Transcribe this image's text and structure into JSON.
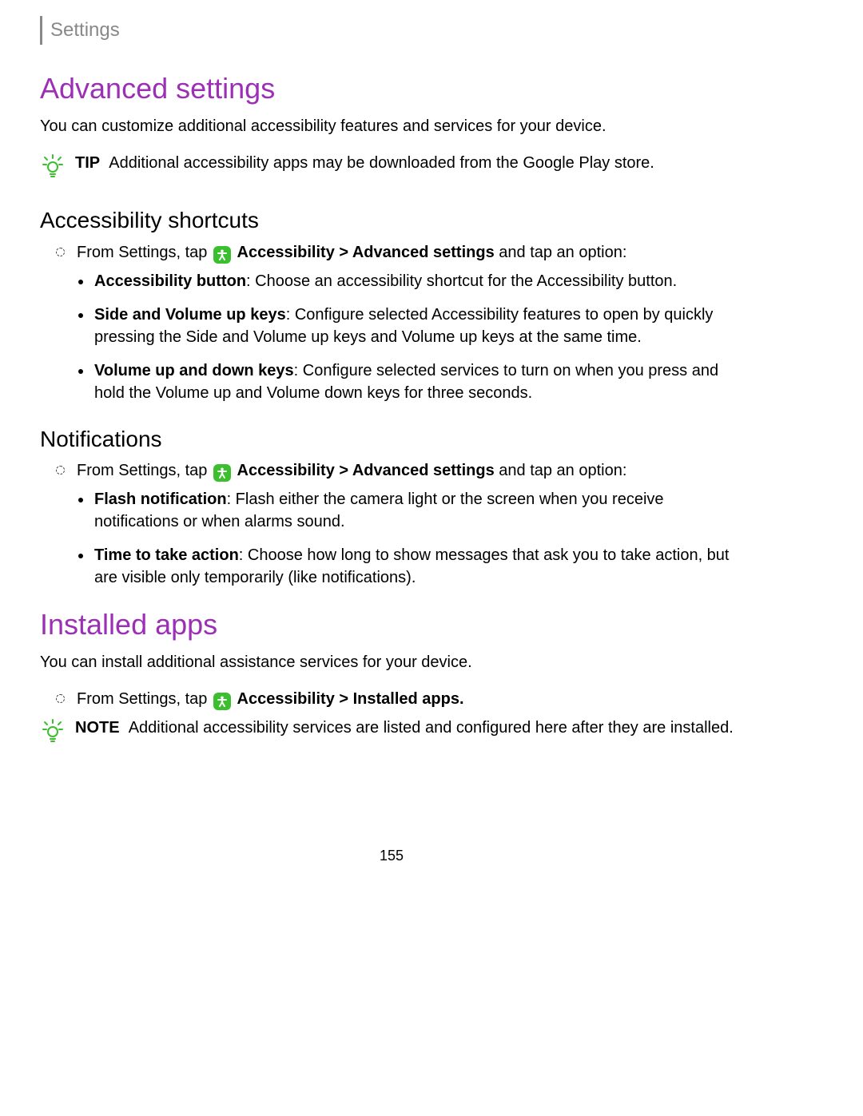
{
  "header": {
    "label": "Settings"
  },
  "advanced": {
    "title": "Advanced settings",
    "intro": "You can customize additional accessibility features and services for your device.",
    "tip": {
      "label": "TIP",
      "text": "Additional accessibility apps may be downloaded from the Google Play store."
    },
    "shortcuts": {
      "title": "Accessibility shortcuts",
      "lead_prefix": "From Settings, tap ",
      "lead_mid": " Accessibility > Advanced settings",
      "lead_suffix": " and tap an option:",
      "items": [
        {
          "label": "Accessibility button",
          "text": ": Choose an accessibility shortcut for the Accessibility button."
        },
        {
          "label": "Side and Volume up keys",
          "text": ": Configure selected Accessibility features to open by quickly pressing the Side and Volume up keys and Volume up keys at the same time."
        },
        {
          "label": "Volume up and down keys",
          "text": ": Configure selected services to turn on when you press and hold the Volume up and Volume down keys for three seconds."
        }
      ]
    },
    "notifications": {
      "title": "Notifications",
      "lead_prefix": "From Settings, tap ",
      "lead_mid": " Accessibility > Advanced settings",
      "lead_suffix": " and tap an option:",
      "items": [
        {
          "label": "Flash notification",
          "text": ": Flash either the camera light or the screen when you receive notifications or when alarms sound."
        },
        {
          "label": "Time to take action",
          "text": ": Choose how long to show messages that ask you to take action, but are visible only temporarily (like notifications)."
        }
      ]
    }
  },
  "installed": {
    "title": "Installed apps",
    "intro": "You can install additional assistance services for your device.",
    "lead_prefix": "From Settings, tap ",
    "lead_mid": " Accessibility > Installed apps.",
    "note": {
      "label": "NOTE",
      "text": "Additional accessibility services are listed and configured here after they are installed."
    }
  },
  "page_number": "155"
}
